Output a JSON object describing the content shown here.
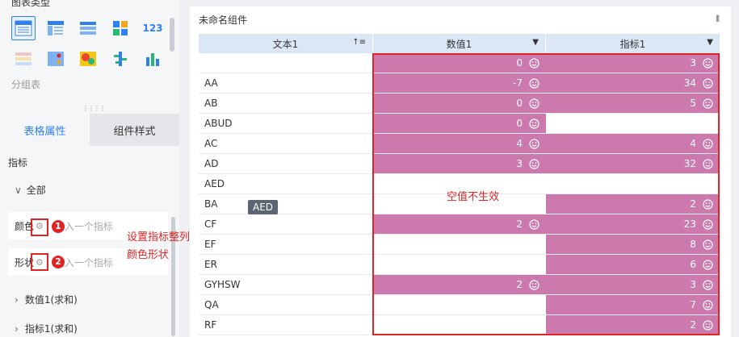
{
  "left_panel": {
    "chart_type_title": "图表类型",
    "chart_type_label": "分组表",
    "chart_icons_row1": [
      "table-icon",
      "grouped-table-icon",
      "cross-table-icon",
      "heatmap-grid-icon",
      "number-icon"
    ],
    "chart_icon_number_text": "123",
    "chart_icons_row2": [
      "small-multiples-icon",
      "dot-table-icon",
      "heat-map-icon",
      "bar-cluster-icon",
      "column-chart-icon"
    ],
    "tabs": [
      {
        "label": "表格属性",
        "active": true
      },
      {
        "label": "组件样式",
        "active": false
      }
    ],
    "metric_section": "指标",
    "all_label": "全部",
    "color_label": "颜色",
    "shape_label": "形状",
    "drop_placeholder": "拖入一个指标",
    "sub_items": [
      "数值1(求和)",
      "指标1(求和)"
    ],
    "badges": [
      "1",
      "2"
    ]
  },
  "annotations": {
    "setting_note_line1": "设置指标整列的",
    "setting_note_line2": "颜色形状",
    "empty_note": "空值不生效"
  },
  "tooltip": "AED",
  "main": {
    "component_title": "未命名组件",
    "columns": [
      "文本1",
      "数值1",
      "指标1"
    ],
    "rows": [
      {
        "text": "",
        "v1": "0",
        "v2": "3"
      },
      {
        "text": "AA",
        "v1": "-7",
        "v2": "34"
      },
      {
        "text": "AB",
        "v1": "0",
        "v2": "5"
      },
      {
        "text": "ABUD",
        "v1": "0",
        "v2": ""
      },
      {
        "text": "AC",
        "v1": "4",
        "v2": "4"
      },
      {
        "text": "AD",
        "v1": "3",
        "v2": "32"
      },
      {
        "text": "AED",
        "v1": "",
        "v2": ""
      },
      {
        "text": "BA",
        "v1": "",
        "v2": "2"
      },
      {
        "text": "CF",
        "v1": "2",
        "v2": "23"
      },
      {
        "text": "EF",
        "v1": "",
        "v2": "8"
      },
      {
        "text": "ER",
        "v1": "",
        "v2": "6"
      },
      {
        "text": "GYHSW",
        "v1": "2",
        "v2": "3"
      },
      {
        "text": "QA",
        "v1": "",
        "v2": "7"
      },
      {
        "text": "RF",
        "v1": "",
        "v2": "2"
      }
    ]
  },
  "colors": {
    "accent": "#2f80ed",
    "fill": "#cc7aad",
    "annotation": "#e02424"
  }
}
